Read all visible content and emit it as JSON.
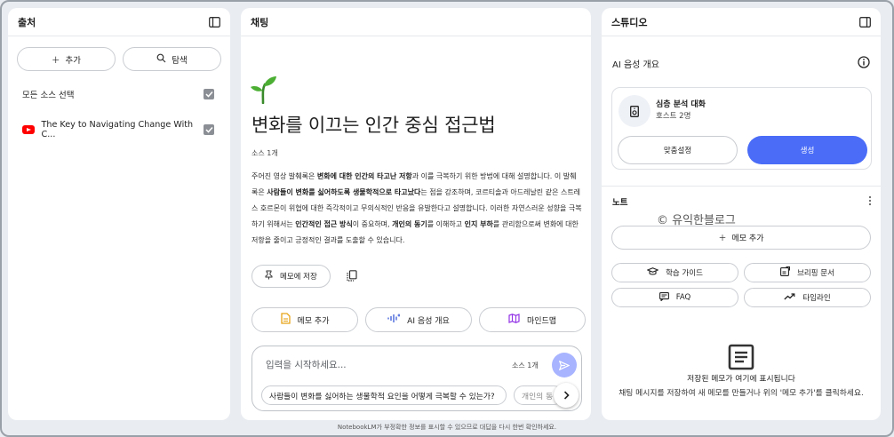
{
  "sources": {
    "title": "출처",
    "add_label": "추가",
    "explore_label": "탐색",
    "select_all_label": "모든 소스 선택",
    "items": [
      {
        "label": "The Key to Navigating Change With C...",
        "type": "youtube"
      }
    ]
  },
  "chat": {
    "title": "채팅",
    "heading": "변화를 이끄는 인간 중심 접근법",
    "source_count": "소스 1개",
    "summary_html": [
      [
        "주어진 영상 발췌록은 ",
        false
      ],
      [
        "변화에 대한 인간의 타고난 저항",
        true
      ],
      [
        "과 이를 극복하기 위한 방법에 대해 설명합니다. 이 발췌록은 ",
        false
      ],
      [
        "사람들이 변화를 싫어하도록 생물학적으로 타고났다",
        true
      ],
      [
        "는 점을 강조하며, 코르티솔과 아드레날린 같은 스트레스 호르몬이 위협에 대한 즉각적이고 무의식적인 반응을 유발한다고 설명합니다. 이러한 자연스러운 성향을 극복하기 위해서는 ",
        false
      ],
      [
        "인간적인 접근 방식",
        true
      ],
      [
        "이 중요하며, ",
        false
      ],
      [
        "개인의 동기",
        true
      ],
      [
        "를 이해하고 ",
        false
      ],
      [
        "인지 부하",
        true
      ],
      [
        "를 관리함으로써 변화에 대한 저항을 줄이고 긍정적인 결과를 도출할 수 있습니다.",
        false
      ]
    ],
    "save_label": "메모에 저장",
    "actions": [
      "메모 추가",
      "AI 음성 개요",
      "마인드맵"
    ],
    "input_placeholder": "입력을 시작하세요...",
    "input_source_count": "소스 1개",
    "suggestions": [
      "사람들이 변화를 싫어하는 생물학적 요인을 어떻게 극복할 수 있는가?",
      "개인의 동"
    ]
  },
  "studio": {
    "title": "스튜디오",
    "audio_overview_label": "AI 음성 개요",
    "audio_card_title": "심층 분석 대화",
    "audio_card_host": "호스트 2명",
    "customize_label": "맞춤설정",
    "generate_label": "생성",
    "notes_label": "노트",
    "add_note_label": "메모 추가",
    "tools": [
      "학습 가이드",
      "브리핑 문서",
      "FAQ",
      "타임라인"
    ],
    "watermark": "© 유익한블로그",
    "empty_title": "저장된 메모가 여기에 표시됩니다",
    "empty_desc": "채팅 메시지를 저장하여 새 메모를 만들거나 위의 '메모 추가'를 클릭하세요."
  },
  "footer": "NotebookLM가 부정확한 정보를 표시할 수 있으므로 대답을 다시 한번 확인하세요.",
  "colors": {
    "accent": "#4a6cf7",
    "send": "#a8b4ff",
    "youtube": "#ff0000"
  }
}
